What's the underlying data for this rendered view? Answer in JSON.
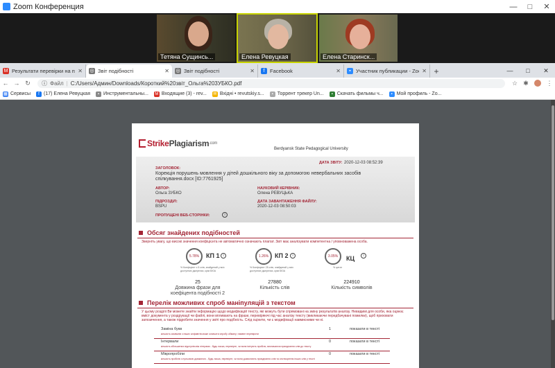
{
  "zoom": {
    "title": "Zoom Конференция",
    "controls": [
      "—",
      "□",
      "✕"
    ],
    "participants": [
      {
        "name": "Тетяна Сущинсь..."
      },
      {
        "name": "Елена Ревуцкая"
      },
      {
        "name": "Елена Старинск..."
      }
    ]
  },
  "tabs": [
    {
      "label": "Результати перевірки на плагіат",
      "icon": "gmail-icon"
    },
    {
      "label": "Звіт подібності",
      "icon": "document-icon"
    },
    {
      "label": "Звіт подібності",
      "icon": "globe-icon"
    },
    {
      "label": "Facebook",
      "icon": "facebook-icon"
    },
    {
      "label": "Участник публикации - Zoom",
      "icon": "zoom-icon"
    }
  ],
  "new_tab": "+",
  "window_controls": [
    "—",
    "□",
    "✕"
  ],
  "address": {
    "protocol_label": "Файл",
    "url": "C:/Users/Админ/Downloads/Короткий%20звіт_Ольга%203УБКО.pdf"
  },
  "bookmarks": [
    {
      "label": "Сервисы",
      "color": "#4285f4"
    },
    {
      "label": "(17) Елена Ревуцкая",
      "color": "#1877f2"
    },
    {
      "label": "Инструментальны...",
      "color": "#888888"
    },
    {
      "label": "Входящие (3) - rev...",
      "color": "#d93025"
    },
    {
      "label": "Вхідні • revutskiy.s...",
      "color": "#f4b400"
    },
    {
      "label": "Торрент трекер Un...",
      "color": "#aaaaaa"
    },
    {
      "label": "Скачать фильмы ч...",
      "color": "#2e7d32"
    },
    {
      "label": "Мой профиль - Zo...",
      "color": "#2d8cff"
    }
  ],
  "report": {
    "logo_strike": "Strike",
    "logo_plag": "Plagiarism",
    "logo_com": ".com",
    "university": "Berdyansk State Pedagogical University",
    "report_date_label": "ДАТА ЗВІТУ:",
    "report_date": "2020-12-03 08:52:39",
    "title_label": "ЗАГОЛОВОК:",
    "title": "Корекція порушень мовлення у дітей дошкільного віку за допомогою невербальних засобів спілкування.docx [ID:7761925]",
    "author_label": "АВТОР:",
    "author": "Ольга ЗУБКО",
    "supervisor_label": "НАУКОВИЙ КЕРІВНИК:",
    "supervisor": "Олена РЕВУЦЬКА",
    "division_label": "ПІДРОЗДІЛ:",
    "division": "BSPU",
    "upload_label": "ДАТА ЗАВАНТАЖЕННЯ ФАЙЛУ:",
    "upload_date": "2020-12-03 08:50:03",
    "skipped_label": "ПРОПУЩЕНІ ВЕБ-СТОРІНКИ:",
    "info_glyph": "i",
    "section1_title": "Обсяг знайдених подібностей",
    "section1_note": "Зверніть увагу, що високі значення коефіцієнта не автоматично означають плагіат. Звіт має аналізувати компетентна / уповноважена особа.",
    "kp1_pct": "5.78%",
    "kp1_label": "КП 1",
    "kp1_note": "% Коефіцієнт з 5 слів, знайдений у всіх доступних джерелах, крім БЮА",
    "kp2_pct": "1.26%",
    "kp2_label": "КП 2",
    "kp2_note": "% Коефіцієнт 25 слів, знайдений у всіх доступних джерелах, крім БЮА",
    "kc_pct": "3.05%",
    "kc_label": "КЦ",
    "kc_note": "% цитат",
    "stat1_num": "25",
    "stat1_label": "Довжина фрази для коефіцента подібності 2",
    "stat2_num": "27880",
    "stat2_label": "Кількість слів",
    "stat3_num": "224910",
    "stat3_label": "Кількість символів",
    "section2_title": "Перелік можливих спроб маніпуляцій з текстом",
    "section2_note": "У цьому розділі Ви можете знайти інформацію щодо модифікацій тексту, які можуть бути спрямовані на зміну результатів аналізу. Невидимі для особи, яка оцінює вміст документа у роздрукації чи файлі, вони впливають на фрази, перевіряючі під час аналізу тексту (викликаючи передбачувані помилки), щоб приховати запозичення, а також підробити значення у звіті про подібність. Слід оцінити, чи є модифікації навмисними чи ні.",
    "rows": [
      {
        "name": "Заміна букв",
        "count": "1",
        "link": "показати в тексті",
        "desc": "кількість символів з інших алфавітів може означати спробу обману; наявне перевірити"
      },
      {
        "name": "Інтервали",
        "count": "0",
        "link": "показати в тексті",
        "desc": "кількість збільшених відступів між літерами - будь ласка, перевірте, чи вони імітують пробіли, визначаючи приєднання слів до тексту"
      },
      {
        "name": "Мікропробіли",
        "count": "0",
        "link": "показати в тексті",
        "desc": "кількість пробілів з нульовою довжиною - будь ласка, перевірте, чи вони дозволяють приєднання слів та спотворення інших слів у тексті"
      }
    ]
  }
}
